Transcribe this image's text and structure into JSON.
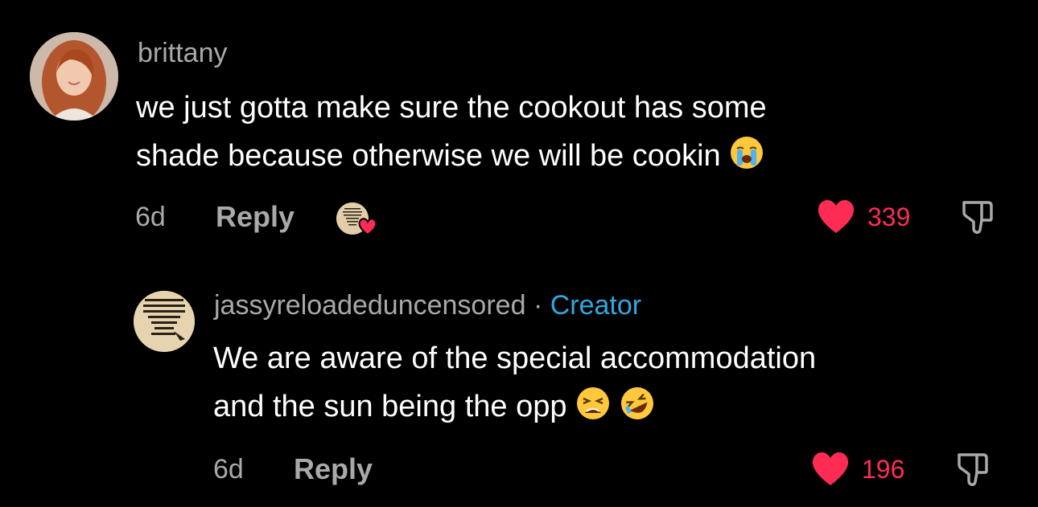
{
  "comments": [
    {
      "username": "brittany",
      "text_line1": "we just gotta make sure the cookout has some",
      "text_line2": "shade because otherwise we will be cookin",
      "text_line2_emoji": "loudly-crying-face-emoji",
      "time": "6d",
      "reply_label": "Reply",
      "likes": "339",
      "creator_liked": true
    },
    {
      "username": "jassyreloadeduncensored",
      "separator": "·",
      "badge": "Creator",
      "text_line1": "We are aware of the special accommodation",
      "text_line2": "and the sun being the opp",
      "text_line2_emojis": [
        "weary-face-emoji",
        "rolling-on-floor-laughing-emoji"
      ],
      "time": "6d",
      "reply_label": "Reply",
      "likes": "196"
    }
  ],
  "avatar_quote_text": [
    "THE ONLY THING",
    "NECESSARY FOR",
    "THE TRIUMPH OF",
    "EVIL IS FOR",
    "GOOD MEN",
    "TO DO",
    "NOTHING"
  ],
  "colors": {
    "background": "#000000",
    "text": "#ffffff",
    "muted": "#a9a9a9",
    "like": "#fe2c55",
    "creator": "#2fa9e0"
  }
}
